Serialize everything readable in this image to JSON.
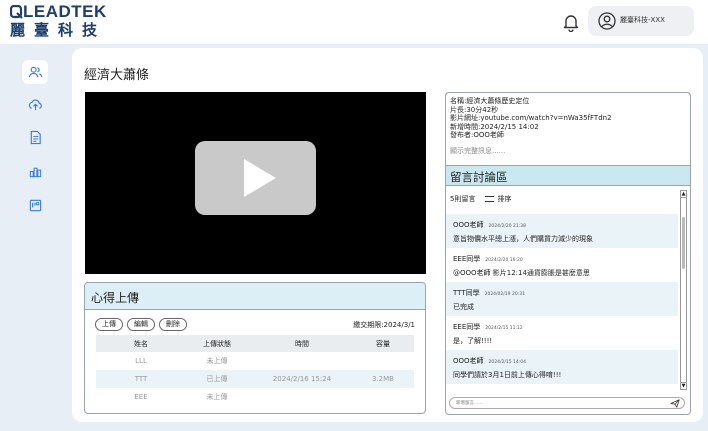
{
  "brand": {
    "name_en": "LEADTEK",
    "name_zh": "麗臺科技"
  },
  "header": {
    "user_name": "麗臺科技-XXX",
    "notification_icon": "bell-icon",
    "avatar_icon": "user-circle-icon"
  },
  "sidebar": {
    "items": [
      {
        "icon": "users-icon",
        "active": true
      },
      {
        "icon": "upload-cloud-icon",
        "active": false
      },
      {
        "icon": "document-icon",
        "active": false
      },
      {
        "icon": "bar-chart-icon",
        "active": false
      },
      {
        "icon": "board-icon",
        "active": false
      }
    ]
  },
  "page": {
    "title": "經濟大蕭條"
  },
  "video": {
    "play_icon": "play-icon"
  },
  "upload": {
    "title": "心得上傳",
    "buttons": {
      "upload": "上傳",
      "edit": "編輯",
      "delete": "刪除"
    },
    "deadline": "繳交期限:2024/3/1",
    "columns": [
      "姓名",
      "上傳狀態",
      "時間",
      "容量"
    ],
    "rows": [
      {
        "name": "LLL",
        "status": "未上傳",
        "time": "",
        "size": ""
      },
      {
        "name": "TTT",
        "status": "已上傳",
        "time": "2024/2/16 15:24",
        "size": "3.2MB"
      },
      {
        "name": "EEE",
        "status": "未上傳",
        "time": "",
        "size": ""
      }
    ]
  },
  "info": {
    "lines": [
      "名稱:經濟大蕭條歷史定位",
      "片長:30分42秒",
      "影片網址:youtube.com/watch?v=nWa35fFTdn2",
      "新增時間:2024/2/15 14:02",
      "發布者:OOO老師"
    ],
    "more": "顯示完整訊息......"
  },
  "discussion": {
    "title": "留言討論區",
    "count": "5則留言",
    "sort_label": "排序",
    "comments": [
      {
        "author": "OOO老師",
        "time": "2024/2/20 21:38",
        "text": "意旨物價水平總上漲，人們購買力減少的現象"
      },
      {
        "author": "EEE同學",
        "time": "2024/2/20 16:20",
        "text": "@OOO老師 影片12:14通貨膨脹是甚麼意思"
      },
      {
        "author": "TTT同學",
        "time": "2024/02/19 20:31",
        "text": "已完成"
      },
      {
        "author": "EEE同學",
        "time": "2024/2/15 11:12",
        "text": "是，了解!!!!"
      },
      {
        "author": "OOO老師",
        "time": "2024/2/15 14:04",
        "text": "同學們請於3月1日前上傳心得唷!!!"
      }
    ],
    "input_placeholder": "新增留言......",
    "send_icon": "send-icon"
  }
}
